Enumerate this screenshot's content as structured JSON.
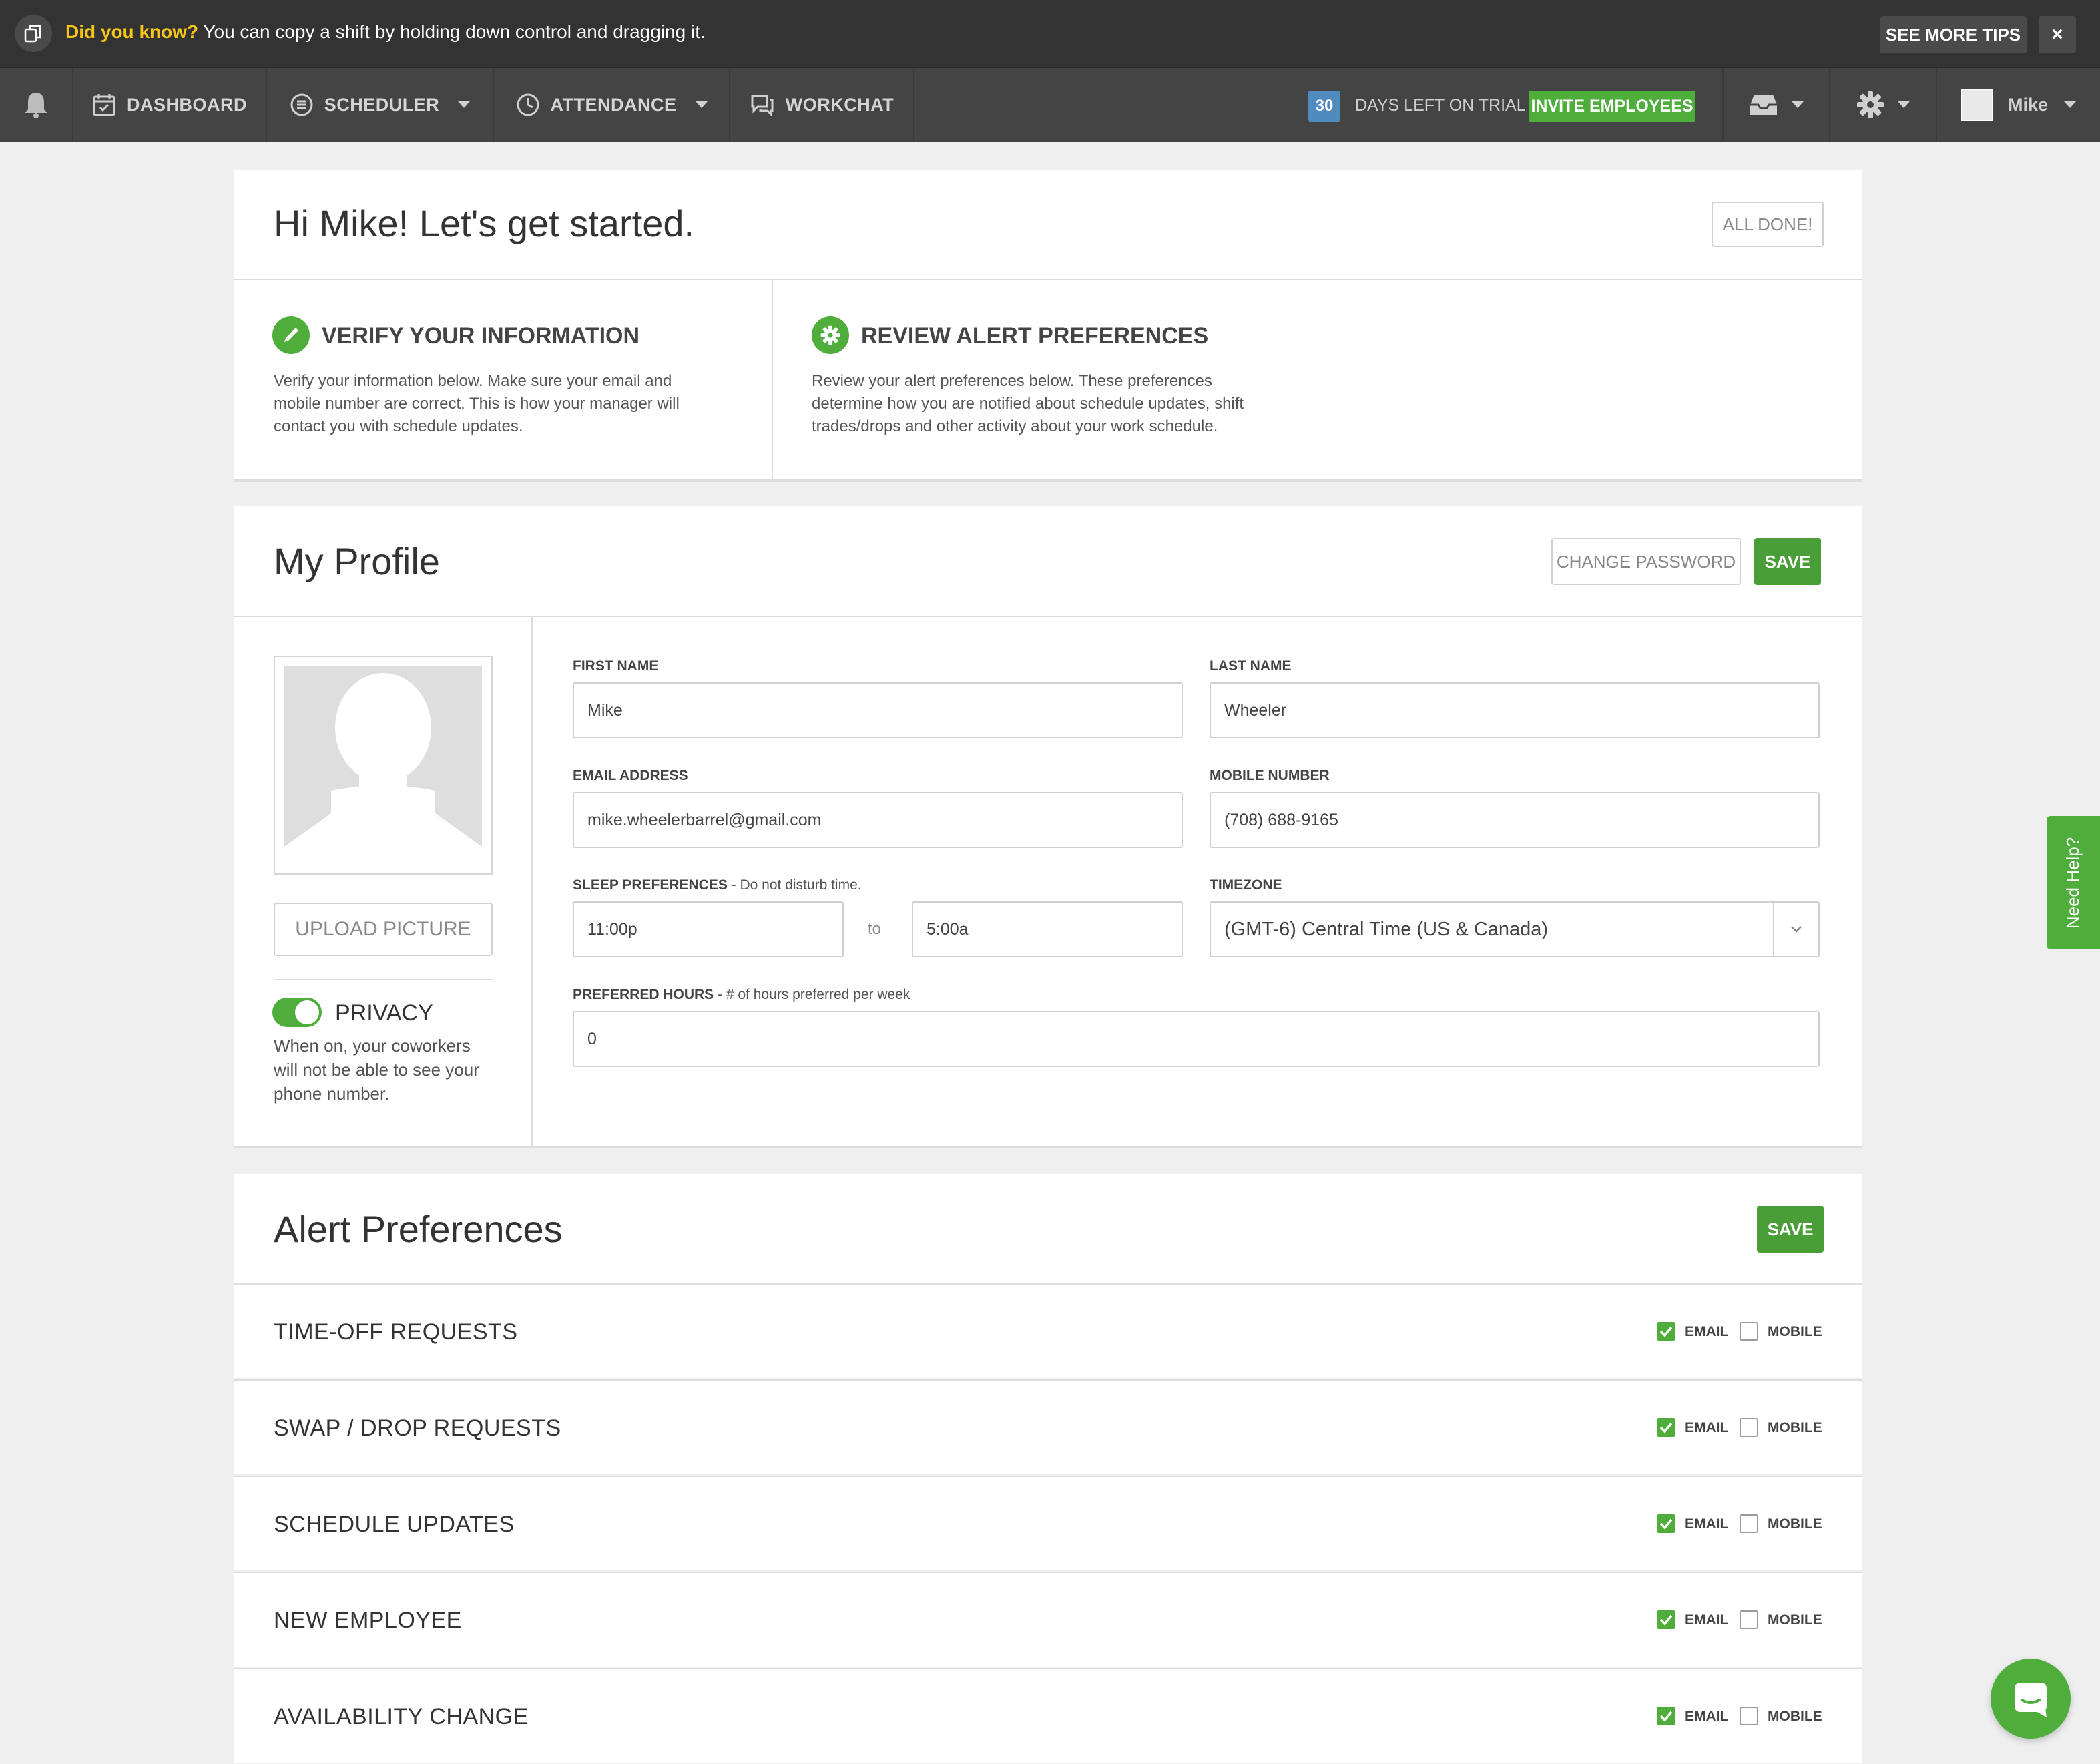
{
  "tips": {
    "highlight": "Did you know?",
    "text": "You can copy a shift by holding down control and dragging it.",
    "see_more": "SEE MORE TIPS",
    "close": "×"
  },
  "nav": {
    "items": [
      {
        "label": "DASHBOARD",
        "icon": "calendar-icon"
      },
      {
        "label": "SCHEDULER",
        "icon": "scheduler-icon"
      },
      {
        "label": "ATTENDANCE",
        "icon": "clock-icon"
      },
      {
        "label": "WORKCHAT",
        "icon": "chat-icon"
      }
    ],
    "trial_days": "30",
    "trial_text": "DAYS LEFT ON TRIAL",
    "invite": "INVITE EMPLOYEES",
    "user": "Mike"
  },
  "getting_started": {
    "title": "Hi Mike! Let's get started.",
    "all_done": "ALL DONE!",
    "steps": [
      {
        "title": "VERIFY YOUR INFORMATION",
        "text": "Verify your information below. Make sure your email and mobile number are correct. This is how your manager will contact you with schedule updates."
      },
      {
        "title": "REVIEW ALERT PREFERENCES",
        "text": "Review your alert preferences below. These preferences determine how you are notified about schedule updates, shift trades/drops and other activity about your work schedule."
      }
    ]
  },
  "profile": {
    "title": "My Profile",
    "change_password": "CHANGE PASSWORD",
    "save": "SAVE",
    "upload": "UPLOAD PICTURE",
    "privacy_label": "PRIVACY",
    "privacy_on": true,
    "privacy_text": "When on, your coworkers will not be able to see your phone number.",
    "first_name_label": "FIRST NAME",
    "first_name": "Mike",
    "last_name_label": "LAST NAME",
    "last_name": "Wheeler",
    "email_label": "EMAIL ADDRESS",
    "email": "mike.wheelerbarrel@gmail.com",
    "mobile_label": "MOBILE NUMBER",
    "mobile": "(708) 688-9165",
    "sleep_label": "SLEEP PREFERENCES",
    "sleep_sub": " - Do not disturb time.",
    "sleep_from": "11:00p",
    "sleep_to_label": "to",
    "sleep_to": "5:00a",
    "timezone_label": "TIMEZONE",
    "timezone": "(GMT-6) Central Time (US & Canada)",
    "hours_label": "PREFERRED HOURS",
    "hours_sub": " - # of hours preferred per week",
    "hours": "0"
  },
  "alerts": {
    "title": "Alert Preferences",
    "save": "SAVE",
    "email_label": "EMAIL",
    "mobile_label": "MOBILE",
    "rows": [
      {
        "label": "TIME-OFF REQUESTS",
        "email": true,
        "mobile": false
      },
      {
        "label": "SWAP / DROP REQUESTS",
        "email": true,
        "mobile": false
      },
      {
        "label": "SCHEDULE UPDATES",
        "email": true,
        "mobile": false
      },
      {
        "label": "NEW EMPLOYEE",
        "email": true,
        "mobile": false
      },
      {
        "label": "AVAILABILITY CHANGE",
        "email": true,
        "mobile": false
      }
    ]
  },
  "need_help": "Need Help?",
  "colors": {
    "accent": "#4fae3b",
    "nav": "#444444",
    "tips": "#333333",
    "trial": "#4f8bbf",
    "highlight": "#f5c518"
  }
}
